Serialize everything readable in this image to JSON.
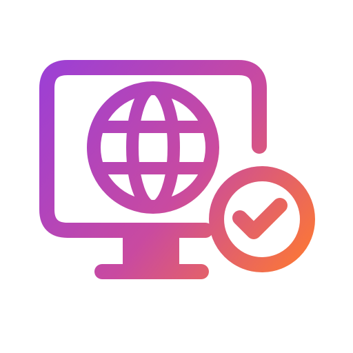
{
  "icon": {
    "name": "web-monitor-verified-icon",
    "gradient": {
      "start": "#9b3fd6",
      "middle": "#c94aa0",
      "end": "#ff7a2f"
    },
    "background": "#ffffff"
  }
}
